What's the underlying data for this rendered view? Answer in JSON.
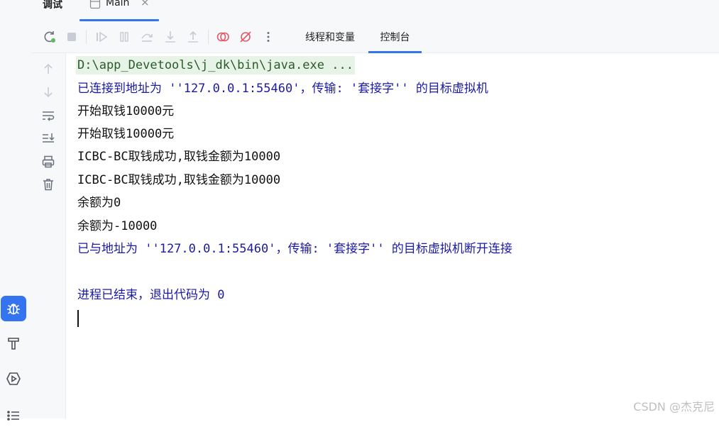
{
  "header": {
    "tool_title": "调试",
    "file_tab": {
      "label": "Main",
      "close_glyph": "×"
    }
  },
  "toolbar": {
    "icons": [
      "rerun-icon",
      "stop-icon",
      "resume-icon",
      "pause-icon",
      "step-over-icon",
      "step-into-icon",
      "step-out-icon",
      "view-breakpoints-icon",
      "mute-breakpoints-icon",
      "more-icon"
    ],
    "tabs": [
      {
        "label": "线程和变量",
        "active": false
      },
      {
        "label": "控制台",
        "active": true
      }
    ]
  },
  "gutter": {
    "icons": [
      "arrow-up-icon",
      "arrow-down-icon",
      "soft-wrap-icon",
      "scroll-to-end-icon",
      "print-icon",
      "clear-all-icon"
    ]
  },
  "left_stripe": {
    "icons": [
      "debug-bug-icon",
      "build-hammer-icon",
      "services-run-icon",
      "structure-list-icon"
    ]
  },
  "console": {
    "lines": [
      {
        "kind": "cmd",
        "text": "D:\\app_Devetools\\j_dk\\bin\\java.exe ..."
      },
      {
        "kind": "sys",
        "text": "已连接到地址为 ''127.0.0.1:55460'，传输: '套接字'' 的目标虚拟机"
      },
      {
        "kind": "out",
        "text": "开始取钱10000元"
      },
      {
        "kind": "out",
        "text": "开始取钱10000元"
      },
      {
        "kind": "out",
        "text": "ICBC-BC取钱成功,取钱金额为10000"
      },
      {
        "kind": "out",
        "text": "ICBC-BC取钱成功,取钱金额为10000"
      },
      {
        "kind": "out",
        "text": "余额为0"
      },
      {
        "kind": "out",
        "text": "余额为-10000"
      },
      {
        "kind": "sys",
        "text": "已与地址为 ''127.0.0.1:55460'，传输: '套接字'' 的目标虚拟机断开连接"
      },
      {
        "kind": "blank",
        "text": ""
      },
      {
        "kind": "sys",
        "text": "进程已结束，退出代码为 0"
      }
    ]
  },
  "watermark": "CSDN @杰克尼",
  "colors": {
    "accent": "#3574f0",
    "console_system": "#1a1aa6",
    "cmd_bg": "#e6f3e6"
  }
}
